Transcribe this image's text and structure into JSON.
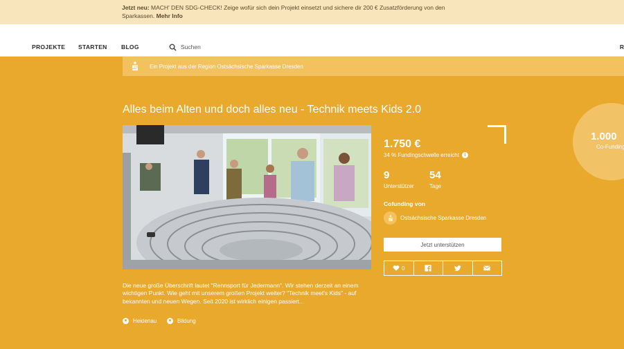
{
  "banner": {
    "prefix": "Jetzt neu:",
    "text": "MACH' DEN SDG-CHECK! Zeige wofür sich dein Projekt einsetzt und sichere dir 200 € Zusatzförderung von den",
    "text2": "Sparkassen.",
    "link": "Mehr Info"
  },
  "nav": {
    "items": [
      "PROJEKTE",
      "STARTEN",
      "BLOG"
    ],
    "search_placeholder": "Suchen",
    "edge_label": "R"
  },
  "region": {
    "text": "Ein Projekt aus der Region Ostsächsische Sparkasse Dresden"
  },
  "project": {
    "title": "Alles beim Alten und doch alles neu - Technik meets Kids 2.0",
    "amount": "1.750 €",
    "threshold": "34 % Fundingschwelle erreicht",
    "info_glyph": "i",
    "supporters_count": "9",
    "supporters_label": "Unterstützer",
    "days_count": "54",
    "days_label": "Tage",
    "cofunding_heading": "Cofunding von",
    "cofunder_name": "Ostsächsische Sparkasse Dresden",
    "support_button": "Jetzt unterstützen",
    "likes": "0",
    "description": "Die neue große Überschrift lautet \"Rennsport für Jedermann\". Wir stehen derzeit an einem wichtigen Punkt. Wie geht mit unserem großen Projekt weiter? \"Technik meet's Kids\" - auf bekannten und neuen Wegen. Seit 2020 ist wirklich einigen passiert...",
    "tags": [
      "Heidenau",
      "Bildung"
    ]
  },
  "badge": {
    "number": "1.000",
    "label": "Co-Funding"
  },
  "icons": {
    "search": "search-icon",
    "sparkasse": "sparkasse-logo-icon",
    "heart": "heart-icon",
    "facebook": "facebook-icon",
    "twitter": "twitter-icon",
    "mail": "mail-icon",
    "location": "location-icon",
    "category": "category-icon"
  },
  "colors": {
    "accent": "#e9a92c",
    "banner_bg": "#f8e5bb",
    "region_bg": "#f3c25e",
    "badge_bg": "#f2c266"
  }
}
